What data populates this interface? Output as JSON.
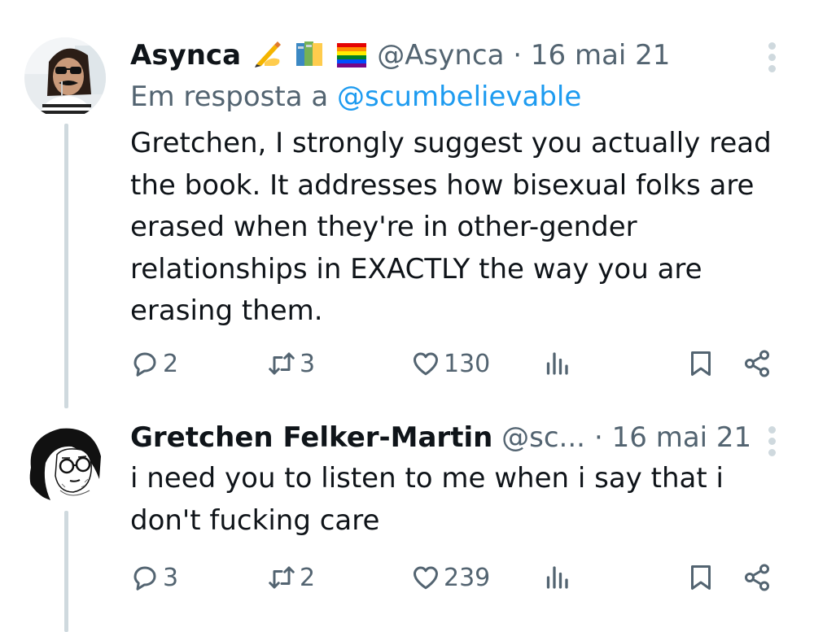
{
  "tweets": [
    {
      "display_name": "Asynca",
      "emojis": [
        "writing-hand-emoji",
        "books-emoji",
        "rainbow-flag-emoji"
      ],
      "handle": "@Asynca",
      "separator": "·",
      "date": "16 mai 21",
      "reply_prefix": "Em resposta a",
      "reply_mention": "@scumbelievable",
      "text": "Gretchen, I strongly suggest you actually read the book. It addresses how bisexual folks are erased when they're in other-gender relationships in EXACTLY the way you are erasing them.",
      "replies": "2",
      "retweets": "3",
      "likes": "130"
    },
    {
      "display_name": "Gretchen Felker-Martin",
      "handle": "@sc...",
      "separator": "·",
      "date": "16 mai 21",
      "text": "i need you to listen to me when i say that i don't fucking care",
      "replies": "3",
      "retweets": "2",
      "likes": "239"
    }
  ],
  "colors": {
    "text": "#0f1419",
    "secondary": "#536471",
    "link": "#1d9bf0",
    "thread_line": "#cfd9de"
  }
}
